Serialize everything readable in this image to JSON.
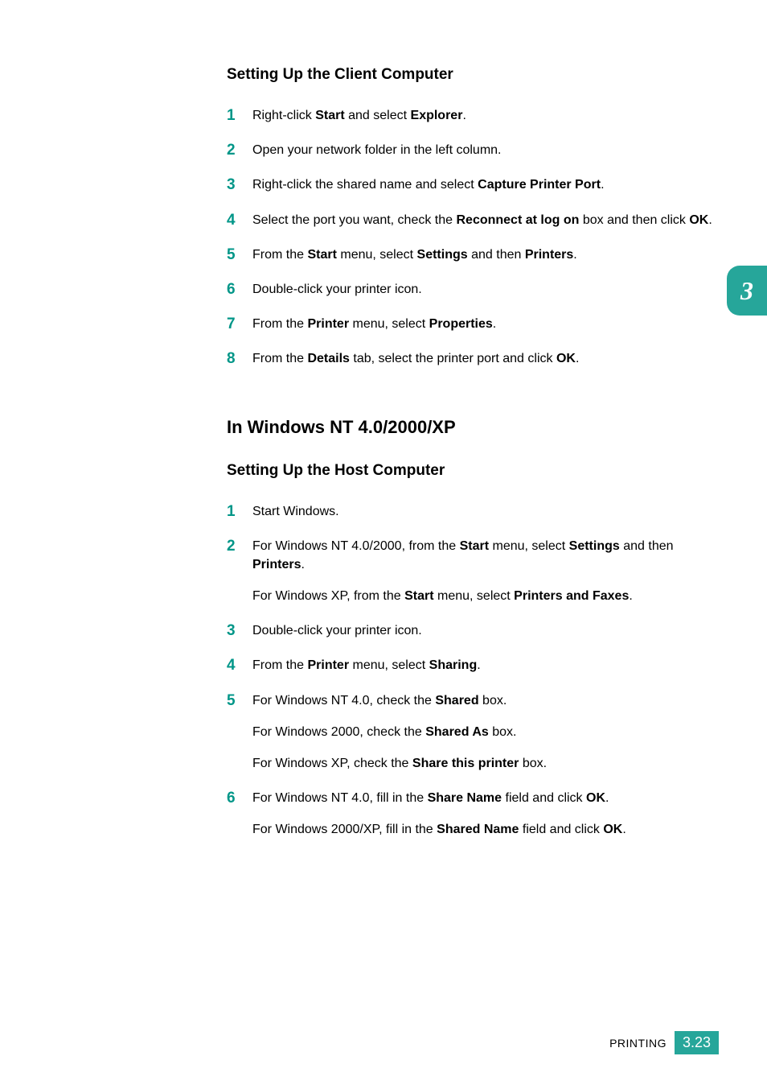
{
  "chapterTab": "3",
  "section1": {
    "heading": "Setting Up the Client Computer",
    "steps": [
      [
        {
          "t": "Right-click "
        },
        {
          "t": "Start",
          "b": true
        },
        {
          "t": " and select "
        },
        {
          "t": "Explorer",
          "b": true
        },
        {
          "t": "."
        }
      ],
      [
        {
          "t": "Open your network folder in the left column."
        }
      ],
      [
        {
          "t": "Right-click the shared name and select "
        },
        {
          "t": "Capture Printer Port",
          "b": true
        },
        {
          "t": "."
        }
      ],
      [
        {
          "t": "Select the port you want, check the "
        },
        {
          "t": "Reconnect at log on",
          "b": true
        },
        {
          "t": " box and then click "
        },
        {
          "t": "OK",
          "b": true
        },
        {
          "t": "."
        }
      ],
      [
        {
          "t": "From the "
        },
        {
          "t": "Start",
          "b": true
        },
        {
          "t": " menu, select "
        },
        {
          "t": "Settings",
          "b": true
        },
        {
          "t": " and then "
        },
        {
          "t": "Printers",
          "b": true
        },
        {
          "t": "."
        }
      ],
      [
        {
          "t": "Double-click your printer icon."
        }
      ],
      [
        {
          "t": "From the "
        },
        {
          "t": "Printer",
          "b": true
        },
        {
          "t": " menu, select "
        },
        {
          "t": "Properties",
          "b": true
        },
        {
          "t": "."
        }
      ],
      [
        {
          "t": "From the "
        },
        {
          "t": "Details",
          "b": true
        },
        {
          "t": " tab, select the printer port and click "
        },
        {
          "t": "OK",
          "b": true
        },
        {
          "t": "."
        }
      ]
    ]
  },
  "section2": {
    "title": "In Windows NT 4.0/2000/XP",
    "heading": "Setting Up the Host Computer",
    "steps": [
      {
        "main": [
          {
            "t": "Start Windows."
          }
        ]
      },
      {
        "main": [
          {
            "t": "For Windows NT 4.0/2000, from the "
          },
          {
            "t": "Start",
            "b": true
          },
          {
            "t": " menu, select "
          },
          {
            "t": "Settings",
            "b": true
          },
          {
            "t": " and then "
          },
          {
            "t": "Printers",
            "b": true
          },
          {
            "t": "."
          }
        ],
        "sub": [
          [
            {
              "t": "For Windows XP, from the "
            },
            {
              "t": "Start",
              "b": true
            },
            {
              "t": " menu, select "
            },
            {
              "t": "Printers and Faxes",
              "b": true
            },
            {
              "t": "."
            }
          ]
        ]
      },
      {
        "main": [
          {
            "t": "Double-click your printer icon."
          }
        ]
      },
      {
        "main": [
          {
            "t": "From the "
          },
          {
            "t": "Printer",
            "b": true
          },
          {
            "t": " menu, select "
          },
          {
            "t": "Sharing",
            "b": true
          },
          {
            "t": "."
          }
        ]
      },
      {
        "main": [
          {
            "t": "For Windows NT 4.0, check the "
          },
          {
            "t": "Shared",
            "b": true
          },
          {
            "t": " box."
          }
        ],
        "sub": [
          [
            {
              "t": "For Windows 2000, check the "
            },
            {
              "t": "Shared As",
              "b": true
            },
            {
              "t": " box."
            }
          ],
          [
            {
              "t": "For Windows XP, check the "
            },
            {
              "t": "Share this printer",
              "b": true
            },
            {
              "t": " box."
            }
          ]
        ]
      },
      {
        "main": [
          {
            "t": "For Windows NT 4.0, fill in the "
          },
          {
            "t": "Share Name",
            "b": true
          },
          {
            "t": " field and click "
          },
          {
            "t": "OK",
            "b": true
          },
          {
            "t": "."
          }
        ],
        "sub": [
          [
            {
              "t": "For Windows 2000/XP, fill in the "
            },
            {
              "t": "Shared Name",
              "b": true
            },
            {
              "t": " field and click "
            },
            {
              "t": "OK",
              "b": true
            },
            {
              "t": "."
            }
          ]
        ]
      }
    ]
  },
  "footer": {
    "label": "PRINTING",
    "page": "3.23"
  }
}
